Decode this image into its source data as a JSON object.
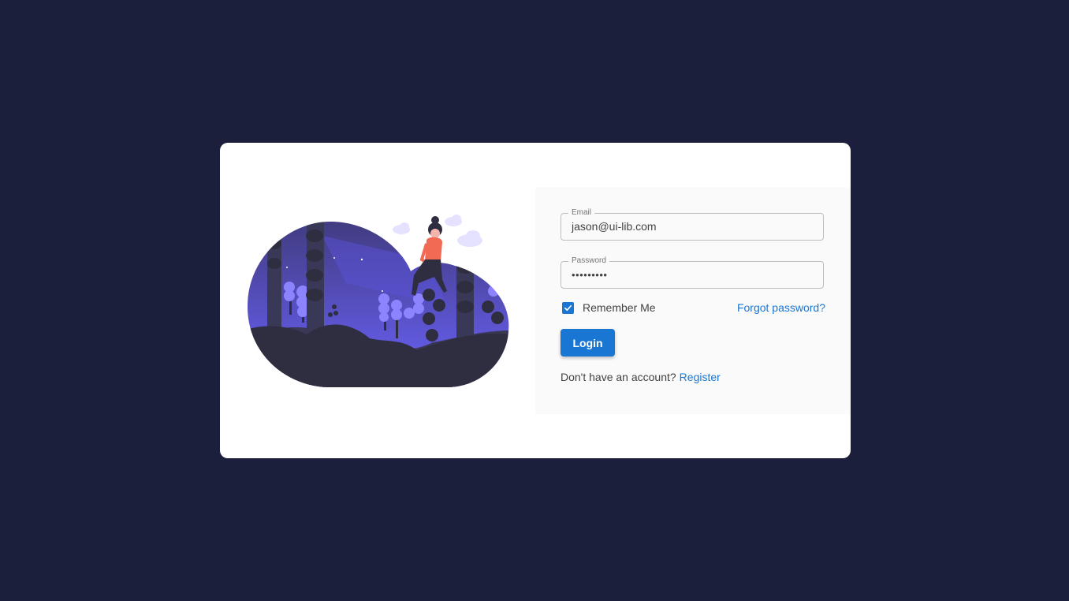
{
  "form": {
    "email": {
      "label": "Email",
      "value": "jason@ui-lib.com"
    },
    "password": {
      "label": "Password",
      "value": "•••••••••"
    },
    "remember": {
      "label": "Remember Me",
      "checked": true
    },
    "forgot_label": "Forgot password?",
    "login_label": "Login",
    "register_prompt": "Don't have an account?",
    "register_label": "Register"
  },
  "colors": {
    "background": "#1c1f3b",
    "card": "#ffffff",
    "panel": "#fafafa",
    "accent": "#1976d2",
    "illustration_purple": "#6c63ff",
    "illustration_dark": "#2f2e41"
  },
  "icons": {
    "checkbox": "check-icon"
  }
}
